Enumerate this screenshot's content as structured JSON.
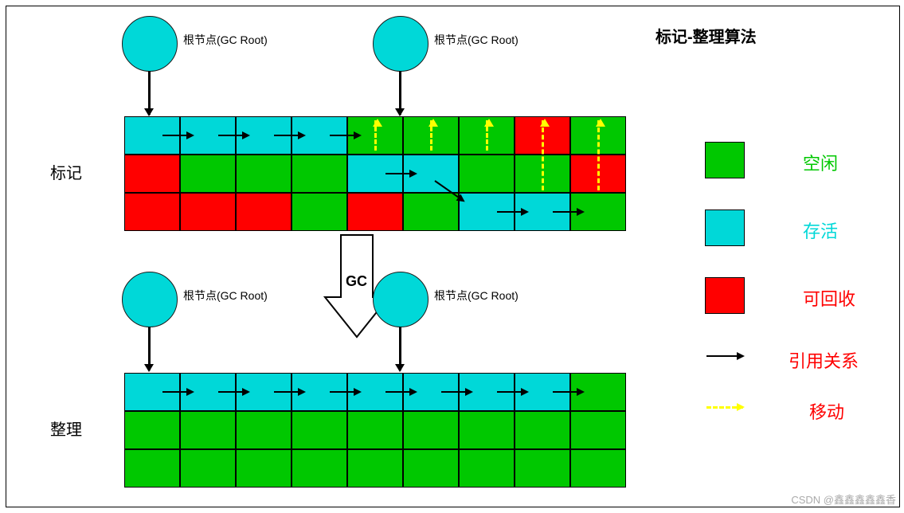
{
  "title": "标记-整理算法",
  "phases": {
    "mark": "标记",
    "compact": "整理"
  },
  "gc_root_label": "根节点(GC Root)",
  "gc_label": "GC",
  "legend": {
    "free": {
      "label": "空闲",
      "color": "#00c800",
      "label_color": "#00c800"
    },
    "alive": {
      "label": "存活",
      "color": "#00d8d8",
      "label_color": "#00d8d8"
    },
    "recycle": {
      "label": "可回收",
      "color": "#ff0000",
      "label_color": "#ff0000"
    },
    "reference": {
      "label": "引用关系",
      "label_color": "#ff0000"
    },
    "move": {
      "label": "移动",
      "label_color": "#ff0000"
    }
  },
  "watermark": "CSDN @鑫鑫鑫鑫鑫香",
  "chart_data": {
    "type": "table",
    "description": "Mark-Compact GC algorithm memory layout before(标记) and after(整理) compaction",
    "cell_states": {
      "C": "cyan/alive",
      "G": "green/free",
      "R": "red/recyclable"
    },
    "before_grid_rows": 3,
    "before_grid_cols": 9,
    "before_grid": [
      [
        "C",
        "C",
        "C",
        "C",
        "G",
        "G",
        "G",
        "R",
        "G"
      ],
      [
        "R",
        "G",
        "G",
        "G",
        "C",
        "C",
        "G",
        "G",
        "R"
      ],
      [
        "R",
        "R",
        "R",
        "G",
        "R",
        "G",
        "C",
        "C",
        "G"
      ]
    ],
    "reference_arrows_before": [
      {
        "row": 0,
        "from_col": 0,
        "to_col": 3,
        "note": "chain of 4 live cells"
      },
      {
        "row": 1,
        "from_col": 4,
        "to_col": 5
      },
      {
        "row": 1,
        "from_col": 5,
        "to_row": 2,
        "to_col": 6,
        "note": "diagonal"
      },
      {
        "row": 2,
        "from_col": 6,
        "to_col": 7
      }
    ],
    "move_arrows_before_cols": [
      4,
      5,
      6,
      7,
      8
    ],
    "gc_roots_before": [
      {
        "points_to_col": 0
      },
      {
        "points_to_col": 4
      }
    ],
    "after_grid_rows": 3,
    "after_grid_cols": 9,
    "after_grid": [
      [
        "C",
        "C",
        "C",
        "C",
        "C",
        "C",
        "C",
        "C",
        "G"
      ],
      [
        "G",
        "G",
        "G",
        "G",
        "G",
        "G",
        "G",
        "G",
        "G"
      ],
      [
        "G",
        "G",
        "G",
        "G",
        "G",
        "G",
        "G",
        "G",
        "G"
      ]
    ],
    "reference_arrows_after": [
      {
        "row": 0,
        "from_col": 0,
        "to_col": 7,
        "note": "chain of 8 live cells"
      }
    ],
    "gc_roots_after": [
      {
        "points_to_col": 0
      },
      {
        "points_to_col": 4
      }
    ]
  }
}
